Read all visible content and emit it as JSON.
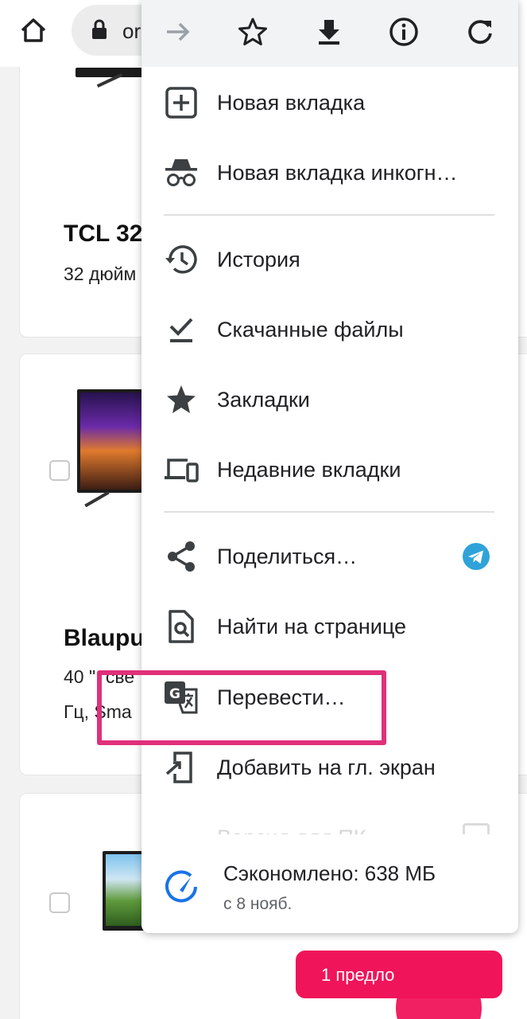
{
  "browser": {
    "url_text": "or",
    "icons": {
      "home": "home-icon",
      "lock": "lock-icon"
    }
  },
  "page": {
    "products": [
      {
        "title": "TCL 32",
        "subtitle": "32 дюйм"
      },
      {
        "title": "Blaupu",
        "subtitle_line1": "40 \", све",
        "subtitle_line2": "Гц, Sma"
      }
    ],
    "offer_button": "1 предло",
    "brand_color": "#f0145a"
  },
  "menu": {
    "top_icons": [
      "forward-arrow-icon",
      "star-outline-icon",
      "download-icon",
      "info-icon",
      "reload-icon"
    ],
    "items": [
      {
        "label": "Новая вкладка",
        "icon": "new-tab-icon"
      },
      {
        "label": "Новая вкладка инкогн…",
        "icon": "incognito-icon"
      },
      {
        "label": "История",
        "icon": "history-icon"
      },
      {
        "label": "Скачанные файлы",
        "icon": "downloads-icon"
      },
      {
        "label": "Закладки",
        "icon": "bookmarks-star-icon"
      },
      {
        "label": "Недавние вкладки",
        "icon": "recent-tabs-devices-icon"
      },
      {
        "label": "Поделиться…",
        "icon": "share-icon"
      },
      {
        "label": "Найти на странице",
        "icon": "find-in-page-icon"
      },
      {
        "label": "Перевести…",
        "icon": "translate-icon"
      },
      {
        "label": "Добавить на гл. экран",
        "icon": "add-to-home-screen-icon"
      },
      {
        "label": "Версия для ПК",
        "icon": "desktop-site-icon"
      }
    ],
    "data_saver": {
      "main": "Сэкономлено: 638 МБ",
      "sub": "с 8 нояб.",
      "icon": "data-saver-gauge-icon"
    }
  },
  "annotation": {
    "highlight_color": "#e0307a",
    "highlighted_item": "Перевести…"
  }
}
